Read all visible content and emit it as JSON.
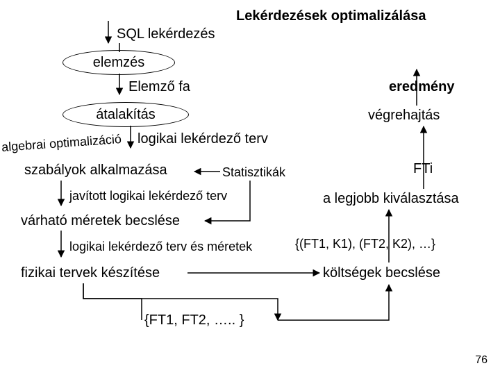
{
  "title": "Lekérdezések optimalizálása",
  "pageNumber": "76",
  "labels": {
    "sqlQuery": "SQL lekérdezés",
    "parseTree": "Elemző fa",
    "algebraOpt": "algebrai optimalizáció",
    "logicalPlan": "logikai lekérdező terv",
    "ruleApplication": "szabályok alkalmazása",
    "improvedLogicalPlan": "javított logikai lekérdező terv",
    "sizeEstimation": "várható méretek becslése",
    "logicalPlanAndSizes": "logikai lekérdező terv és méretek",
    "physicalPlanGeneration": "fizikai tervek készítése",
    "ftSet": "{FT1, FT2, ….. }",
    "statistics": "Statisztikák",
    "fti": "FTi",
    "selectBest": "a legjobb kiválasztása",
    "pairsSet": "{(FT1, K1), (FT2, K2), …}",
    "costEstimation": "költségek becslése",
    "result": "eredmény",
    "execution": "végrehajtás"
  },
  "bubbles": {
    "analysis": "elemzés",
    "transformation": "átalakítás"
  }
}
